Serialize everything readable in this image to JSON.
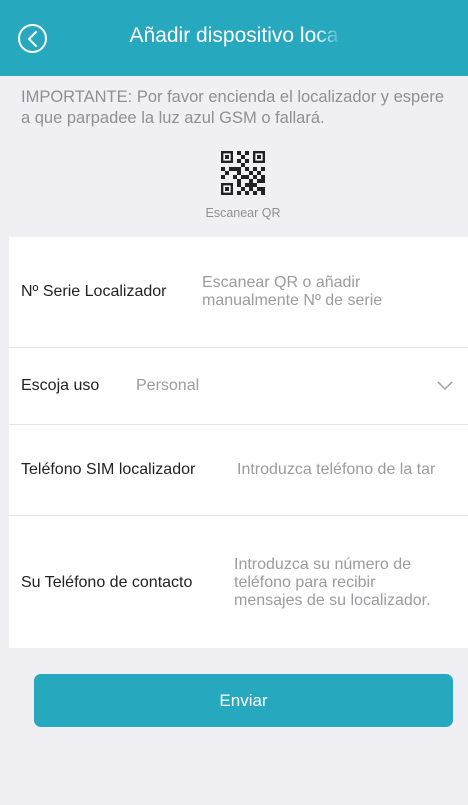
{
  "header": {
    "title": "Añadir dispositivo loca",
    "back_icon": "chevron-left-icon",
    "color": "#26a9be"
  },
  "notice": {
    "line1": "IMPORTANTE: Por favor encienda el localizador y espere",
    "line2": "a que parpadee la luz azul GSM o fallará."
  },
  "scan": {
    "icon": "qr-code-icon",
    "label": "Escanear QR"
  },
  "form": {
    "serial": {
      "label": "Nº Serie Localizador",
      "hint_line1": "Escanear QR o añadir",
      "hint_line2": "manualmente Nº de serie"
    },
    "use": {
      "label": "Escoja uso",
      "value": "Personal",
      "icon": "chevron-down-icon"
    },
    "sim": {
      "label": "Teléfono SIM localizador",
      "placeholder": "Introduzca teléfono de la tar"
    },
    "contact": {
      "label": "Su Teléfono de contacto",
      "hint_line1": "Introduzca su número de",
      "hint_line2": "teléfono para recibir",
      "hint_line3": "mensajes de su localizador."
    }
  },
  "submit": {
    "label": "Enviar"
  }
}
